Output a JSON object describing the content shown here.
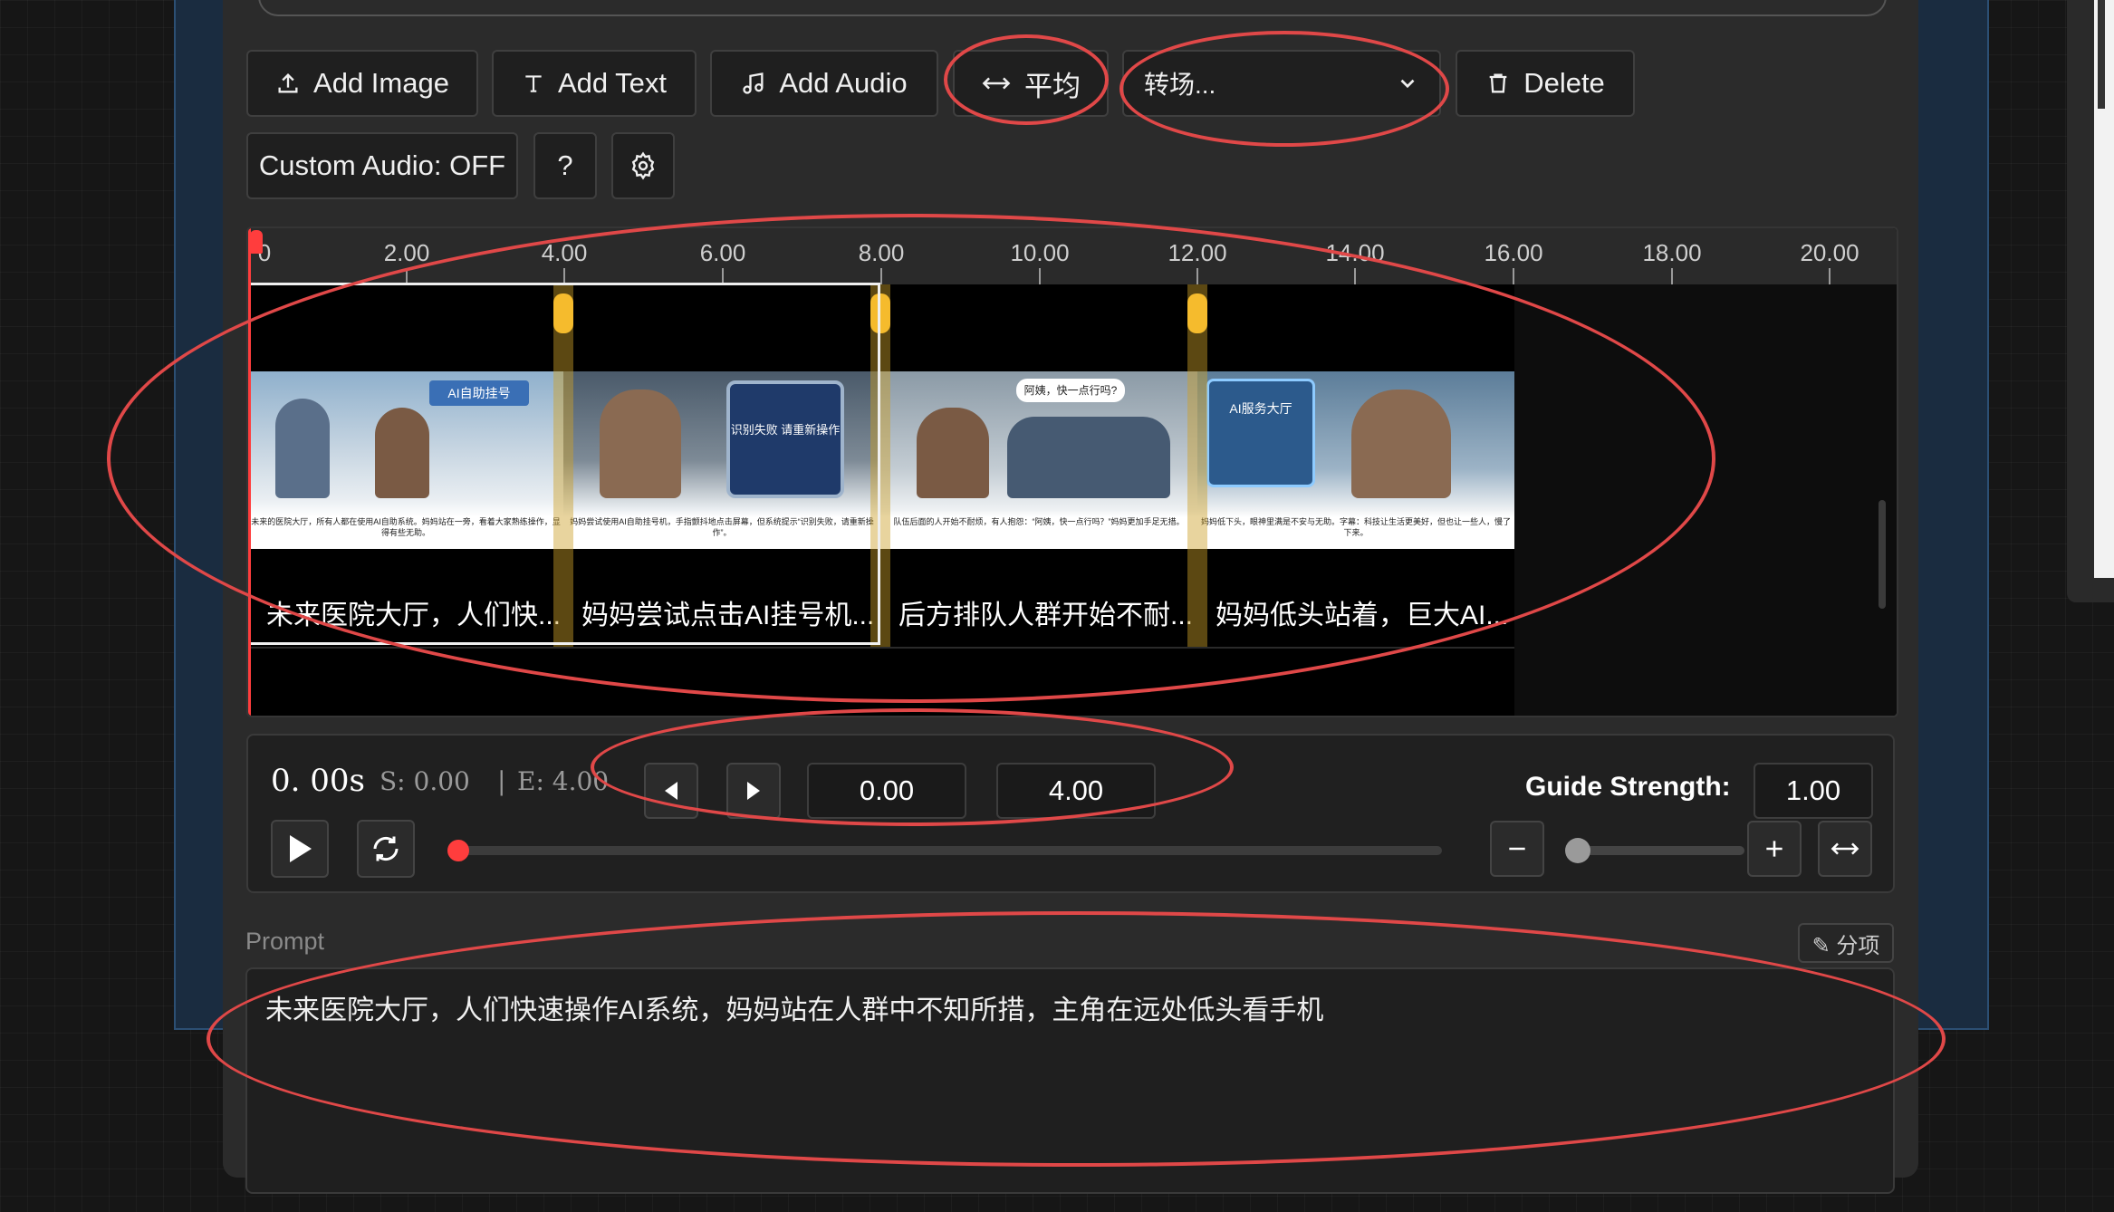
{
  "toolbar": {
    "add_image": "Add Image",
    "add_text": "Add Text",
    "add_audio": "Add Audio",
    "average": "平均",
    "transition_select": "转场...",
    "delete": "Delete",
    "custom_audio": "Custom Audio: OFF",
    "help": "?"
  },
  "ruler": {
    "ticks": [
      "0",
      "2.00",
      "4.00",
      "6.00",
      "8.00",
      "10.00",
      "12.00",
      "14.00",
      "16.00",
      "18.00",
      "20.00"
    ]
  },
  "clips": [
    {
      "caption": "未来医院大厅，人们快...",
      "image_badge": "AI自助挂号",
      "image_text": "未来的医院大厅，所有人都在使用AI自助系统。妈妈站在一旁，看着大家熟练操作，显得有些无助。"
    },
    {
      "caption": "妈妈尝试点击AI挂号机...",
      "image_badge": "识别失败 请重新操作",
      "image_text": "妈妈尝试使用AI自助挂号机，手指颤抖地点击屏幕，但系统提示“识别失败，请重新操作”。"
    },
    {
      "caption": "后方排队人群开始不耐...",
      "image_badge": "阿姨，快一点行吗?",
      "image_text": "队伍后面的人开始不耐烦，有人抱怨：“阿姨，快一点行吗？”妈妈更加手足无措。"
    },
    {
      "caption": "妈妈低头站着，巨大AI...",
      "image_badge": "AI服务大厅",
      "image_text": "妈妈低下头，眼神里满是不安与无助。字幕：科技让生活更美好，但也让一些人，慢了下来。"
    }
  ],
  "controls": {
    "current_time": "0. 00s",
    "start_label": "S: 0.00",
    "separator": "|",
    "end_label": "E: 4.00",
    "start_value": "0.00",
    "end_value": "4.00",
    "guide_label": "Guide Strength:",
    "guide_value": "1.00",
    "progress": 0.0,
    "guide_slider_fraction": 0.0
  },
  "prompt": {
    "label": "Prompt",
    "edit_button": "✎ 分项",
    "text": "未来医院大厅，人们快速操作AI系统，妈妈站在人群中不知所措，主角在远处低头看手机"
  },
  "colors": {
    "accent_handle": "#f5bb2d",
    "playhead": "#ff3d3d",
    "annotation": "#e04848"
  }
}
